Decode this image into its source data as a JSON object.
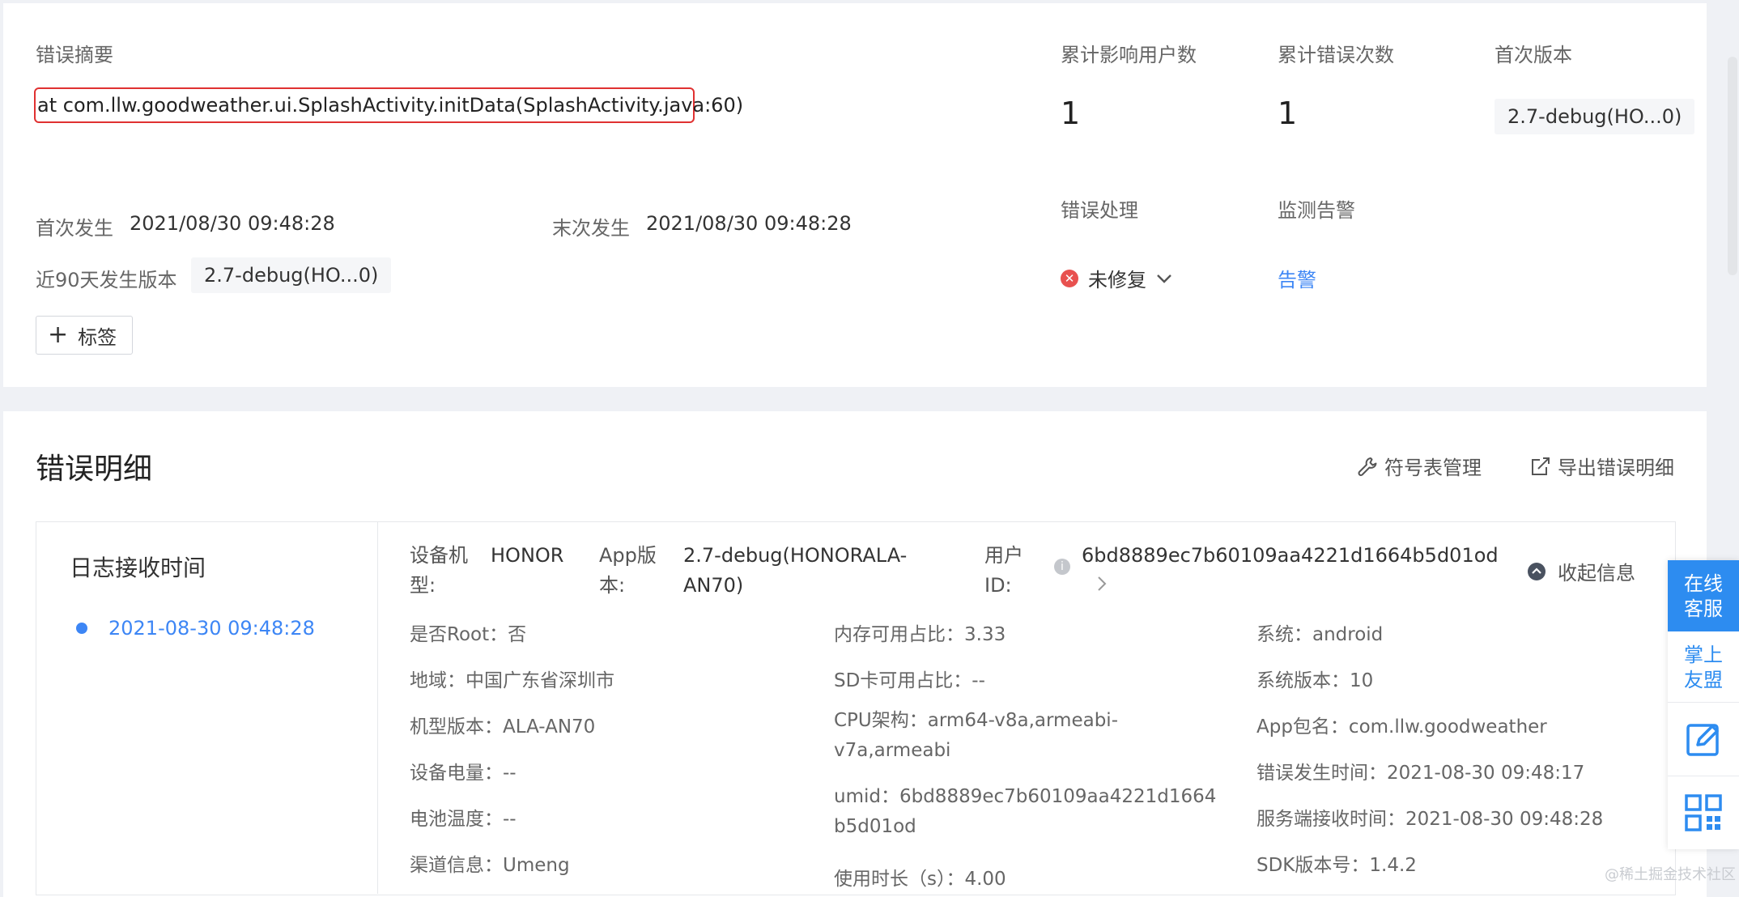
{
  "summary": {
    "title": "错误摘要",
    "text": "at com.llw.goodweather.ui.SplashActivity.initData(SplashActivity.java:60)",
    "first_occurrence_label": "首次发生",
    "first_occurrence_value": "2021/08/30 09:48:28",
    "last_occurrence_label": "末次发生",
    "last_occurrence_value": "2021/08/30 09:48:28",
    "versions_label": "近90天发生版本",
    "versions_value": "2.7-debug(HO...0)",
    "tag_button": "标签"
  },
  "stats": {
    "affected_users_label": "累计影响用户数",
    "affected_users_value": "1",
    "error_count_label": "累计错误次数",
    "error_count_value": "1",
    "first_version_label": "首次版本",
    "first_version_value": "2.7-debug(HO...0)",
    "handling_label": "错误处理",
    "handling_value": "未修复",
    "alert_label": "监测告警",
    "alert_link": "告警"
  },
  "details": {
    "title": "错误明细",
    "symbol_mgmt": "符号表管理",
    "export": "导出错误明细",
    "log_time_header": "日志接收时间",
    "log_time_entry": "2021-08-30 09:48:28",
    "device_label": "设备机型:",
    "device_value": "HONOR",
    "app_version_label": "App版本:",
    "app_version_value": "2.7-debug(HONORALA-AN70)",
    "user_id_label": "用户ID:",
    "user_id_value": "6bd8889ec7b60109aa4221d1664b5d01od",
    "collapse": "收起信息",
    "col1": [
      "是否Root：否",
      "地域：中国广东省深圳市",
      "机型版本：ALA-AN70",
      "设备电量：--",
      "电池温度：--",
      "渠道信息：Umeng"
    ],
    "col2": [
      "内存可用占比：3.33",
      "SD卡可用占比：--",
      "CPU架构：arm64-v8a,armeabi-v7a,armeabi",
      "umid：6bd8889ec7b60109aa4221d1664b5d01od",
      "使用时长（s）：4.00"
    ],
    "col3": [
      "系统：android",
      "系统版本：10",
      "App包名：com.llw.goodweather",
      "错误发生时间：2021-08-30 09:48:17",
      "服务端接收时间：2021-08-30 09:48:28",
      "SDK版本号：1.4.2"
    ]
  },
  "float": {
    "online_service": "在线客服",
    "palm_alliance": "掌上友盟"
  },
  "watermark": "@稀土掘金技术社区"
}
